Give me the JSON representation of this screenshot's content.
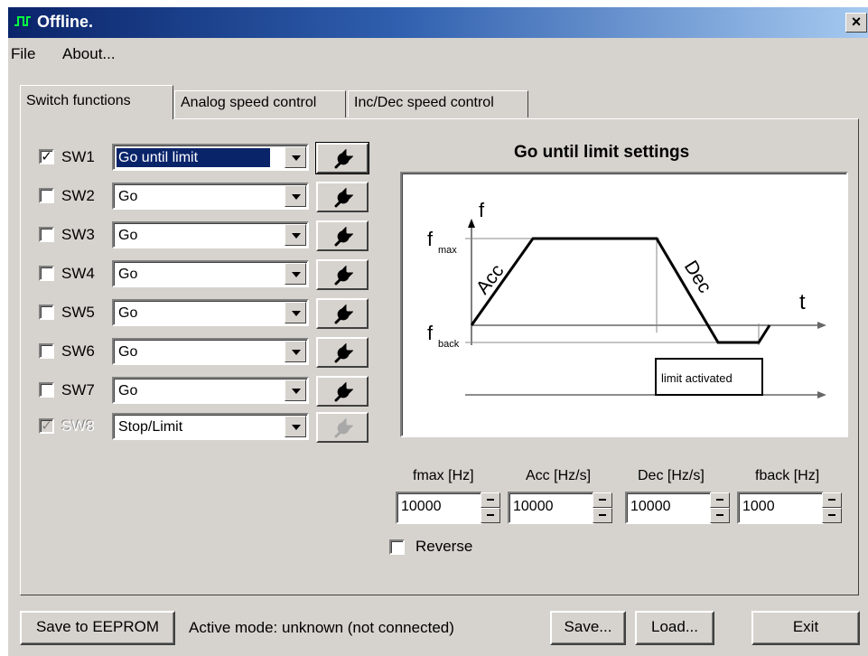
{
  "window": {
    "title": "Offline."
  },
  "menu": {
    "file": "File",
    "about": "About..."
  },
  "tabs": [
    {
      "label": "Switch functions",
      "active": true
    },
    {
      "label": "Analog speed control",
      "active": false
    },
    {
      "label": "Inc/Dec speed control",
      "active": false
    }
  ],
  "switches": [
    {
      "label": "SW1",
      "checked": true,
      "disabled": false,
      "mode": "Go until limit",
      "selected": true
    },
    {
      "label": "SW2",
      "checked": false,
      "disabled": false,
      "mode": "Go",
      "selected": false
    },
    {
      "label": "SW3",
      "checked": false,
      "disabled": false,
      "mode": "Go",
      "selected": false
    },
    {
      "label": "SW4",
      "checked": false,
      "disabled": false,
      "mode": "Go",
      "selected": false
    },
    {
      "label": "SW5",
      "checked": false,
      "disabled": false,
      "mode": "Go",
      "selected": false
    },
    {
      "label": "SW6",
      "checked": false,
      "disabled": false,
      "mode": "Go",
      "selected": false
    },
    {
      "label": "SW7",
      "checked": false,
      "disabled": false,
      "mode": "Go",
      "selected": false
    },
    {
      "label": "SW8",
      "checked": true,
      "disabled": true,
      "mode": "Stop/Limit",
      "selected": false
    }
  ],
  "settings": {
    "title": "Go until limit settings",
    "diagram": {
      "f": "f",
      "t": "t",
      "fmax_main": "f",
      "fmax_sub": "max",
      "fback_main": "f",
      "fback_sub": "back",
      "acc": "Acc",
      "dec": "Dec",
      "limit": "limit activated"
    },
    "params": [
      {
        "label": "fmax [Hz]",
        "value": "10000"
      },
      {
        "label": "Acc [Hz/s]",
        "value": "10000"
      },
      {
        "label": "Dec [Hz/s]",
        "value": "10000"
      },
      {
        "label": "fback [Hz]",
        "value": "1000"
      }
    ],
    "reverse": {
      "label": "Reverse",
      "checked": false
    }
  },
  "footer": {
    "save_eeprom": "Save to EEPROM",
    "status": "Active mode: unknown (not connected)",
    "save": "Save...",
    "load": "Load...",
    "exit": "Exit"
  },
  "colors": {
    "title_start": "#0a246a",
    "title_end": "#a6caf0",
    "face": "#d6d3ce",
    "selection": "#0a246a"
  },
  "icons": {
    "app": "square-wave-icon",
    "tools": "wrench-icon",
    "close": "close-icon"
  }
}
